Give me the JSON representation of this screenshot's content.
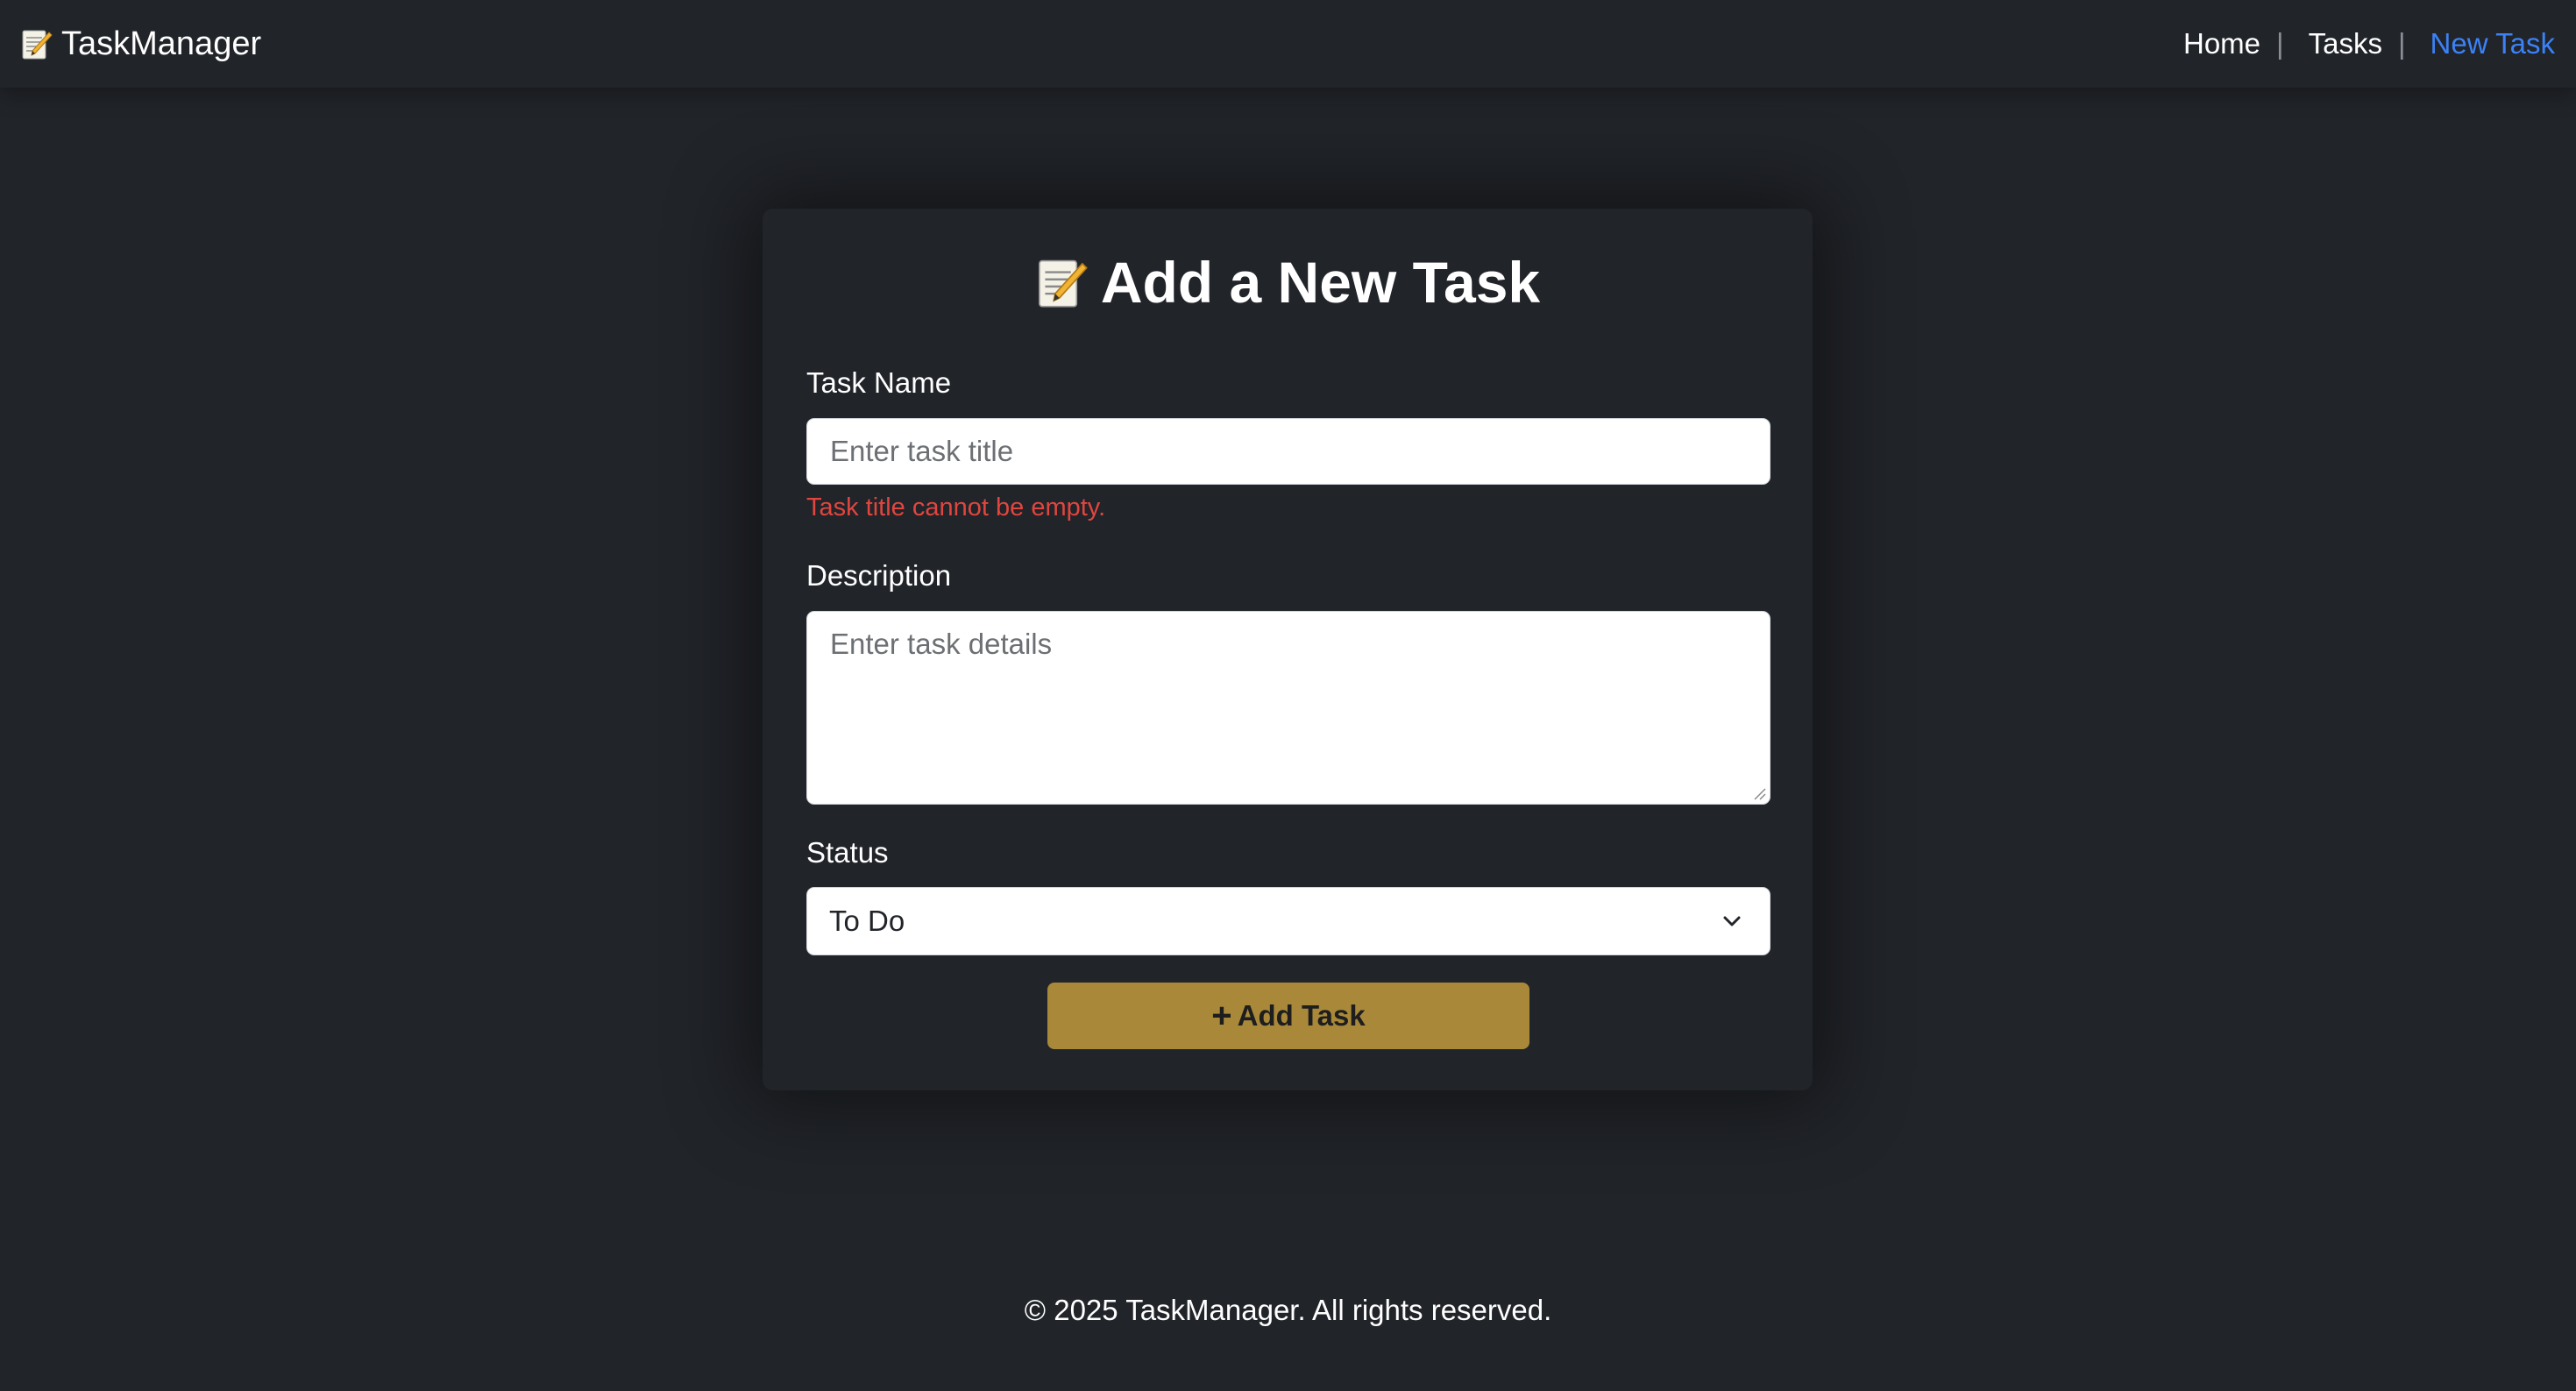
{
  "navbar": {
    "brand": "TaskManager",
    "brand_icon": "memo-pencil-icon",
    "links": [
      {
        "label": "Home"
      },
      {
        "label": "Tasks"
      },
      {
        "label": "New Task",
        "active": true
      }
    ],
    "separator": "|"
  },
  "form": {
    "title": "Add a New Task",
    "title_icon": "memo-pencil-icon",
    "task_name": {
      "label": "Task Name",
      "placeholder": "Enter task title",
      "value": "",
      "error": "Task title cannot be empty."
    },
    "description": {
      "label": "Description",
      "placeholder": "Enter task details",
      "value": ""
    },
    "status": {
      "label": "Status",
      "selected": "To Do"
    },
    "submit": {
      "label": "Add Task",
      "icon": "plus-icon"
    }
  },
  "footer": {
    "text": "© 2025 TaskManager. All rights reserved."
  },
  "colors": {
    "background": "#212429",
    "active_link": "#3b82f6",
    "error": "#e0463f",
    "button": "#a98939"
  }
}
